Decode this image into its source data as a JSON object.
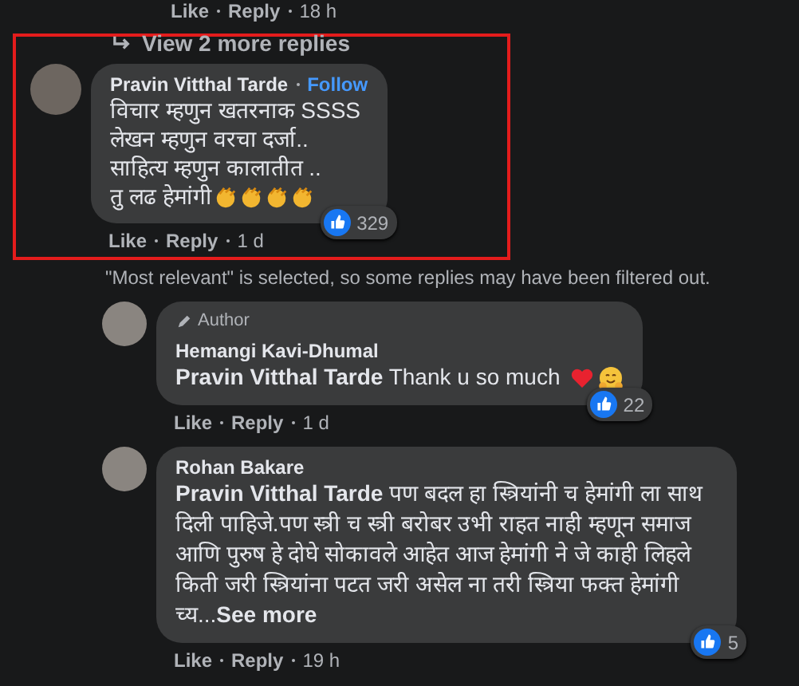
{
  "previous_actions": {
    "like": "Like",
    "reply": "Reply",
    "time": "18 h"
  },
  "highlight": {
    "shown": true
  },
  "view_more": {
    "label": "View 2 more replies"
  },
  "top_comment": {
    "author": "Pravin Vitthal Tarde",
    "follow": "Follow",
    "lines": [
      "विचार म्हणुन खतरनाक SSSS",
      "लेखन म्हणुन वरचा दर्जा..",
      "साहित्य म्हणुन कालातीत ..",
      "तु लढ हेमांगी"
    ],
    "emojis": [
      {
        "kind": "clap"
      },
      {
        "kind": "clap"
      },
      {
        "kind": "clap"
      },
      {
        "kind": "clap"
      }
    ],
    "reactions": "329",
    "like": "Like",
    "reply": "Reply",
    "time": "1 d"
  },
  "filter_notice": "\"Most relevant\" is selected, so some replies may have been filtered out.",
  "replies": [
    {
      "badge": "Author",
      "author": "Hemangi Kavi-Dhumal",
      "mention": "Pravin Vitthal Tarde",
      "text": "Thank u so much",
      "emojis": [
        {
          "kind": "heart"
        },
        {
          "kind": "hug"
        }
      ],
      "reactions": "22",
      "like": "Like",
      "reply": "Reply",
      "time": "1 d"
    },
    {
      "author": "Rohan Bakare",
      "mention": "Pravin Vitthal Tarde",
      "text": "पण बदल हा स्त्रियांनी च हेमांगी ला साथ दिली पाहिजे.पण स्त्री च स्त्री बरोबर उभी राहत नाही म्हणून समाज आणि पुरुष हे दोघे सोकावले आहेत आज हेमांगी ने जे काही लिहले किती जरी स्त्रियांना पटत जरी असेल ना तरी स्त्रिया फक्त हेमांगी च्य...",
      "see_more": "See more",
      "reactions": "5",
      "like": "Like",
      "reply": "Reply",
      "time": "19 h"
    }
  ]
}
